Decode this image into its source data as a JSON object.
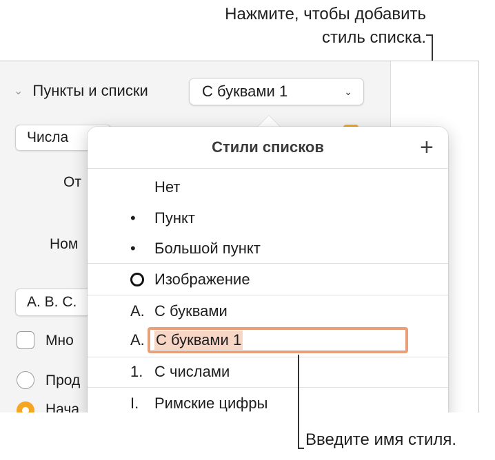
{
  "callouts": {
    "add_style_line1": "Нажмите, чтобы добавить",
    "add_style_line2": "стиль списка.",
    "enter_name": "Введите имя стиля."
  },
  "sidebar": {
    "section_title": "Пункты и списки",
    "style_popup_value": "С буквами 1",
    "numbers_button": "Числа",
    "indent_label": "От",
    "number_label": "Ном",
    "format_button": "A. B. C.",
    "multilevel_label": "Мно",
    "continue_label": "Прод",
    "start_label": "Нача"
  },
  "popover": {
    "title": "Стили списков",
    "add_button": "+",
    "items": [
      {
        "marker": "",
        "label": "Нет"
      },
      {
        "marker": "•",
        "label": "Пункт"
      },
      {
        "marker": "•",
        "label": "Большой пункт"
      },
      {
        "marker": "ring",
        "label": "Изображение"
      },
      {
        "marker": "A.",
        "label": "С буквами"
      },
      {
        "marker": "A.",
        "label": "С буквами 1"
      },
      {
        "marker": "1.",
        "label": "С числами"
      },
      {
        "marker": "I.",
        "label": "Римские цифры"
      }
    ]
  },
  "colors": {
    "accent": "#f5a623",
    "edit_border": "#e8a07a",
    "selection": "#f7d6c5"
  }
}
